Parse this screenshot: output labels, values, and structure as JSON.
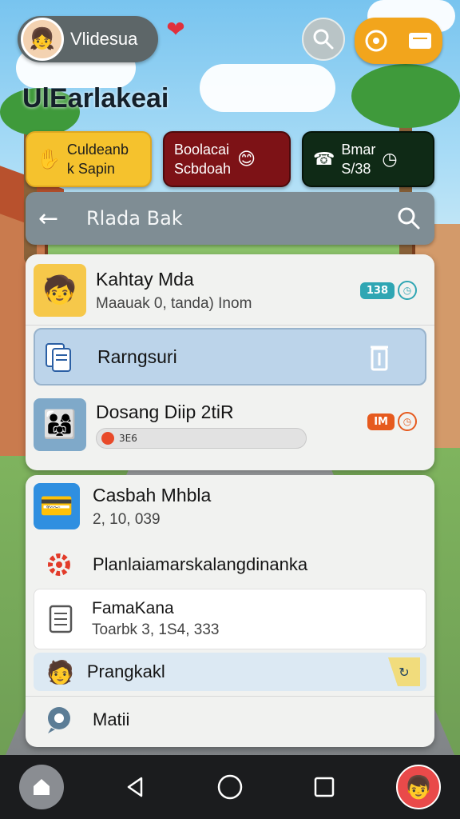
{
  "header": {
    "profile_name": "Vlidesua",
    "app_title": "UlEarlakeai",
    "heart_icon": "heart-icon",
    "search_icon": "search-icon",
    "ticket_icons": [
      "coin-icon",
      "ticket-icon"
    ]
  },
  "quick_cards": [
    {
      "line1": "Culdeanb",
      "line2": "k Sapin",
      "icon": "hands-icon",
      "bg": "#f5c22d"
    },
    {
      "line1": "Boolacai",
      "line2": "Scbdoah",
      "icon": "face-icon",
      "bg": "#7d1216"
    },
    {
      "line1": "Bmar",
      "line2": "S/38",
      "icon": "phone-clock-icon",
      "bg": "#0f2a16"
    }
  ],
  "search": {
    "query": "Rlada Bak"
  },
  "panel1": {
    "items": [
      {
        "title": "Kahtay Mda",
        "subtitle": "Maauak 0, tanda) Inom",
        "tag": "138",
        "tag_color": "#2fa6b3"
      },
      {
        "title": "Rarngsuri",
        "highlighted": true
      },
      {
        "title": "Dosang Diip 2tiR",
        "progress_text": "3E6",
        "tag": "IM",
        "tag_color": "#e65a1e"
      }
    ]
  },
  "panel2": {
    "items": [
      {
        "title": "Casbah Mhbla",
        "subtitle": "2, 10, 039"
      },
      {
        "title": "Planlaiamarskalangdinanka"
      },
      {
        "title": "FamaKana",
        "subtitle": "Toarbk 3, 1S4, 333"
      },
      {
        "title": "Prangkakl"
      },
      {
        "title": "Matii"
      }
    ]
  },
  "nav": {
    "items": [
      "home-icon",
      "back-icon",
      "home-circle-icon",
      "recents-icon",
      "profile-avatar"
    ]
  }
}
